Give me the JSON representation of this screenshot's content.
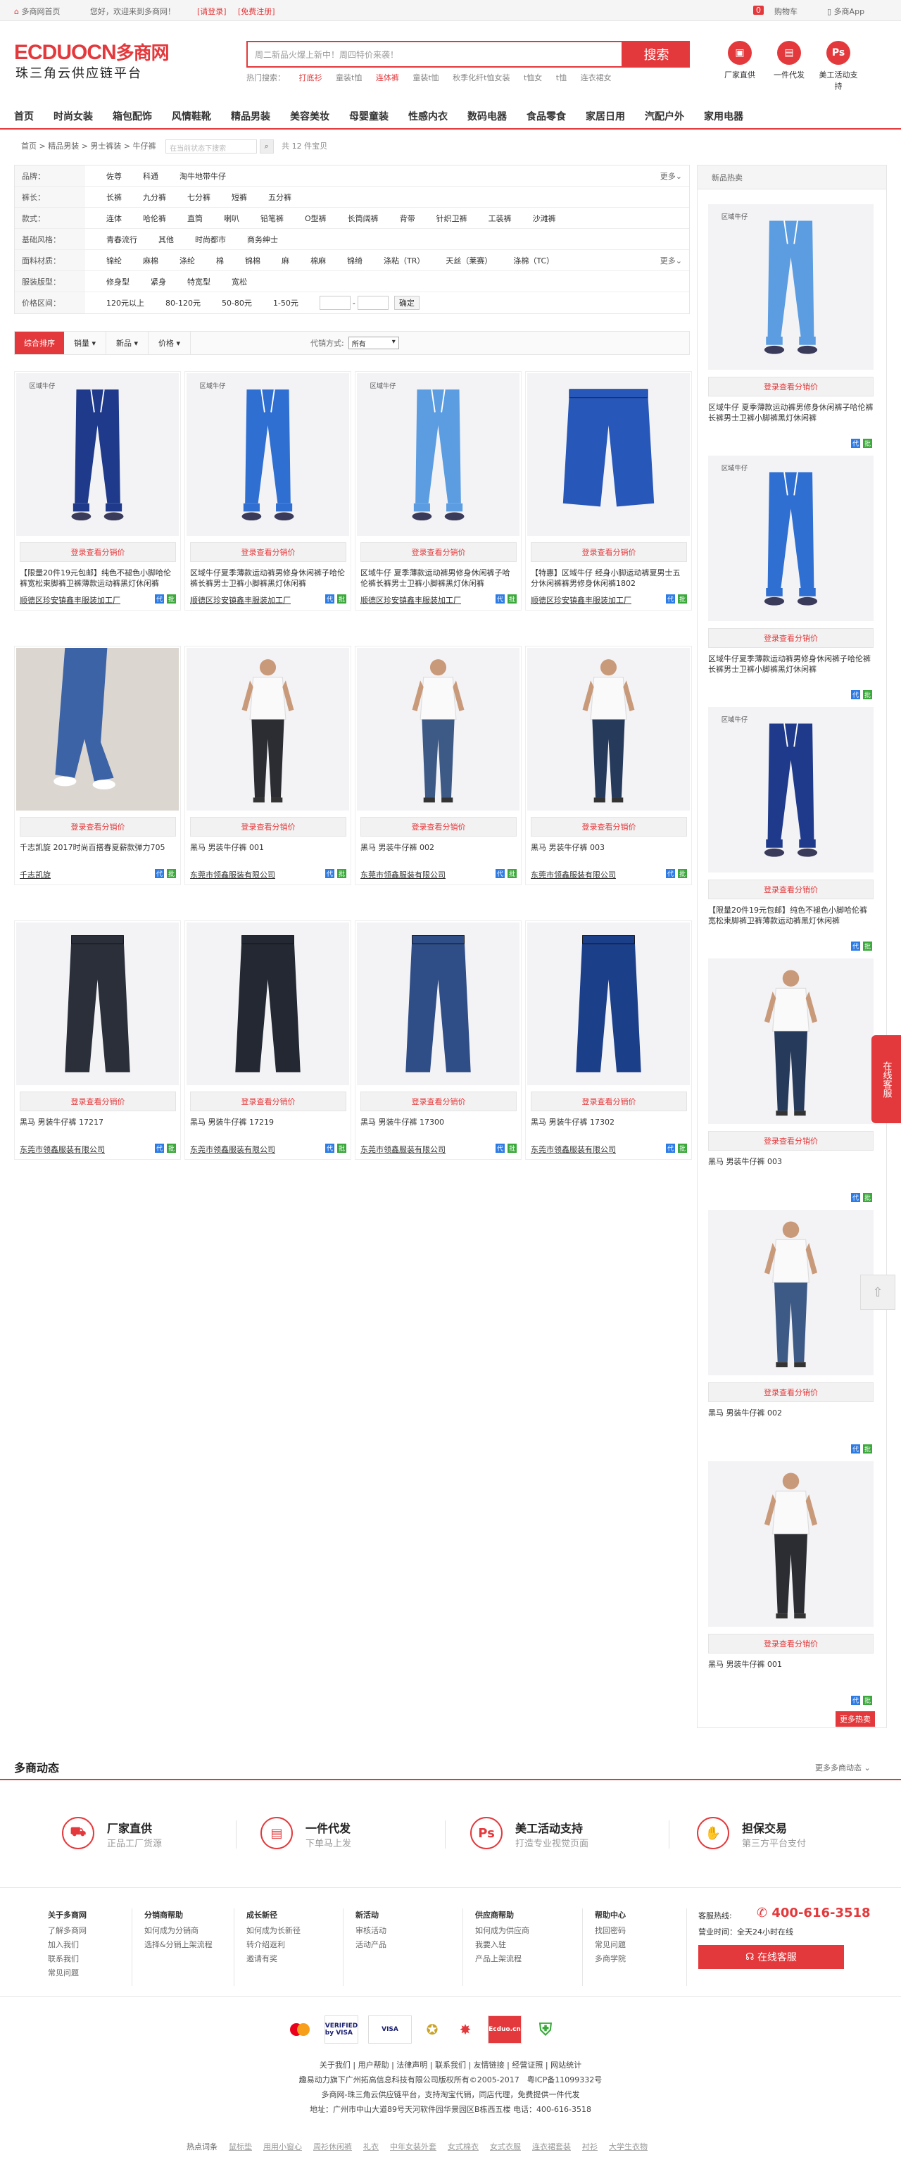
{
  "topbar": {
    "home": "多商网首页",
    "welcome": "您好，欢迎来到多商网！",
    "login": "[请登录]",
    "register": "[免费注册]",
    "cart_count": "0",
    "cart": "购物车",
    "app": "多商App"
  },
  "logo": {
    "brand": "ECDUOCN",
    "cn": "多商网",
    "subtitle": "珠三角云供应链平台"
  },
  "search": {
    "placeholder": "周二新品火爆上新中！周四特价来袭！",
    "button": "搜索",
    "hot_label": "热门搜索：",
    "hot_words": [
      "打底衫",
      "童装t恤",
      "连体裤",
      "童装t恤",
      "秋季化纤t恤女装",
      "t恤女",
      "t恤",
      "连衣裙女"
    ]
  },
  "features": [
    {
      "icon": "factory-icon",
      "label": "厂家直供"
    },
    {
      "icon": "dropship-icon",
      "label": "一件代发"
    },
    {
      "icon": "ps-icon",
      "label": "美工活动支持"
    }
  ],
  "nav": [
    "首页",
    "时尚女装",
    "箱包配饰",
    "风情鞋靴",
    "精品男装",
    "美容美妆",
    "母婴童装",
    "性感内衣",
    "数码电器",
    "食品零食",
    "家居日用",
    "汽配户外",
    "家用电器"
  ],
  "breadcrumb": {
    "items": [
      "首页",
      "精品男装",
      "男士裤装",
      "牛仔裤"
    ],
    "search_placeholder": "在当前状态下搜索",
    "count": "共 12 件宝贝"
  },
  "filters": [
    {
      "label": "品牌：",
      "options": [
        "佐尊",
        "科通",
        "淘牛地带牛仔"
      ],
      "more": "更多"
    },
    {
      "label": "裤长：",
      "options": [
        "长裤",
        "九分裤",
        "七分裤",
        "短裤",
        "五分裤"
      ]
    },
    {
      "label": "款式：",
      "options": [
        "连体",
        "哈伦裤",
        "直筒",
        "喇叭",
        "铅笔裤",
        "O型裤",
        "长筒阔裤",
        "背带",
        "针织卫裤",
        "工装裤",
        "沙滩裤"
      ]
    },
    {
      "label": "基础风格：",
      "options": [
        "青春流行",
        "其他",
        "时尚都市",
        "商务绅士"
      ]
    },
    {
      "label": "面料材质：",
      "options": [
        "锦纶",
        "麻棉",
        "涤纶",
        "棉",
        "锦棉",
        "麻",
        "棉麻",
        "锦绮",
        "涤粘（TR）",
        "天丝（莱赛）",
        "涤棉（TC）"
      ],
      "more": "更多"
    },
    {
      "label": "服装版型：",
      "options": [
        "修身型",
        "紧身",
        "特宽型",
        "宽松"
      ]
    }
  ],
  "price_filter": {
    "label": "价格区间：",
    "options": [
      "120元以上",
      "80-120元",
      "50-80元",
      "1-50元"
    ],
    "dash": "-",
    "confirm": "确定"
  },
  "sortbar": {
    "default": "综合排序",
    "options": [
      "销量 ▾",
      "新品 ▾",
      "价格 ▾"
    ],
    "agent_label": "代销方式:",
    "agent_value": "所有"
  },
  "cta_label": "登录查看分销价",
  "products": [
    {
      "title": "【限量20件19元包邮】纯色不褪色小脚哈伦裤宽松束脚裤卫裤薄款运动裤黑灯休闲裤",
      "seller": "顺德区珍安镇鑫丰服装加工厂",
      "style": "jogger-dark"
    },
    {
      "title": "区域牛仔夏季薄款运动裤男修身休闲裤子哈伦裤长裤男士卫裤小脚裤黑灯休闲裤",
      "seller": "顺德区珍安镇鑫丰服装加工厂",
      "style": "jogger-mid"
    },
    {
      "title": "区域牛仔 夏季薄款运动裤男修身休闲裤子哈伦裤长裤男士卫裤小脚裤黑灯休闲裤",
      "seller": "顺德区珍安镇鑫丰服装加工厂",
      "style": "jogger-light"
    },
    {
      "title": "【特惠】区域牛仔 经身小脚运动裤夏男士五分休闲裤裤男修身休闲裤1802",
      "seller": "顺德区珍安镇鑫丰服装加工厂",
      "style": "shorts"
    },
    {
      "title": "千志凯旋 2017时尚百搭春夏薪款弹力705",
      "seller": "千志凯旋",
      "style": "street"
    },
    {
      "title": "黑马 男装牛仔裤 001",
      "seller": "东莞市领鑫服装有限公司",
      "style": "model-black"
    },
    {
      "title": "黑马 男装牛仔裤 002",
      "seller": "东莞市领鑫服装有限公司",
      "style": "model-ripped"
    },
    {
      "title": "黑马 男装牛仔裤 003",
      "seller": "东莞市领鑫服装有限公司",
      "style": "model-navy"
    },
    {
      "title": "黑马 男装牛仔裤 17217",
      "seller": "东莞市领鑫服装有限公司",
      "style": "flat-black"
    },
    {
      "title": "黑马 男装牛仔裤 17219",
      "seller": "东莞市领鑫服装有限公司",
      "style": "flat-black2"
    },
    {
      "title": "黑马 男装牛仔裤 17300",
      "seller": "东莞市领鑫服装有限公司",
      "style": "flat-blue"
    },
    {
      "title": "黑马 男装牛仔裤 17302",
      "seller": "东莞市领鑫服装有限公司",
      "style": "flat-deep"
    }
  ],
  "sidebar": {
    "heading": "新品热卖",
    "items": [
      {
        "title": "区域牛仔 夏季薄款运动裤男修身休闲裤子哈伦裤长裤男士卫裤小脚裤黑灯休闲裤",
        "style": "jogger-light"
      },
      {
        "title": "区域牛仔夏季薄款运动裤男修身休闲裤子哈伦裤长裤男士卫裤小脚裤黑灯休闲裤",
        "style": "jogger-mid"
      },
      {
        "title": "【限量20件19元包邮】纯色不褪色小脚哈伦裤宽松束脚裤卫裤薄款运动裤黑灯休闲裤",
        "style": "jogger-dark"
      },
      {
        "title": "黑马 男装牛仔裤 003",
        "style": "model-navy"
      },
      {
        "title": "黑马 男装牛仔裤 002",
        "style": "model-ripped"
      },
      {
        "title": "黑马 男装牛仔裤 001",
        "style": "model-black"
      }
    ],
    "more": "更多热卖"
  },
  "float": {
    "customer_service": "在线客服",
    "to_top": "⇧"
  },
  "news": {
    "title": "多商动态",
    "more": "更多多商动态"
  },
  "promises": [
    {
      "icon": "truck-icon",
      "title": "厂家直供",
      "desc": "正品工厂货源"
    },
    {
      "icon": "dropship-icon",
      "title": "一件代发",
      "desc": "下单马上发"
    },
    {
      "icon": "ps-icon",
      "title": "美工活动支持",
      "desc": "打造专业视觉页面"
    },
    {
      "icon": "handshake-icon",
      "title": "担保交易",
      "desc": "第三方平台支付"
    }
  ],
  "footer_cols": [
    {
      "head": "关于多商网",
      "links": [
        "了解多商网",
        "加入我们",
        "联系我们",
        "常见问题"
      ]
    },
    {
      "head": "分销商帮助",
      "links": [
        "如何成为分销商",
        "选择&分销上架流程"
      ]
    },
    {
      "head": "成长新径",
      "links": [
        "如何成为长新径",
        "转介绍返利",
        "邀请有奖"
      ]
    },
    {
      "head": "新活动",
      "links": [
        "审核活动",
        "活动产品"
      ]
    },
    {
      "head": "供应商帮助",
      "links": [
        "如何成为供应商",
        "我要入驻",
        "产品上架流程"
      ]
    },
    {
      "head": "帮助中心",
      "links": [
        "找回密码",
        "常见问题",
        "多商学院"
      ]
    }
  ],
  "contact": {
    "hotline_label": "客服热线:",
    "hotline": "400-616-3518",
    "service_time": "营业时间：全天24小时在线",
    "online_button": "在线客服"
  },
  "certs": [
    "MasterCard",
    "VERIFIED by VISA",
    "VISA",
    "诚信网站",
    "可信网站",
    "Ecduo.cn",
    "安全认证"
  ],
  "footer_links": "关于我们 | 用户帮助 | 法律声明 | 联系我们 | 友情链接 | 经营证照 | 网站统计",
  "copyright": [
    "趣易动力旗下广州拓高信息科技有限公司版权所有©2005-2017　粤ICP备11099332号",
    "多商网-珠三角云供应链平台，支持淘宝代销，同店代理，免费提供一件代发",
    "地址：广州市中山大道89号天河软件园华景园区B栋西五楼 电话：400-616-3518"
  ],
  "hot_search": {
    "label": "热点词条",
    "words": [
      "鼠标垫",
      "用用小窗心",
      "周衫休闲裤",
      "礼衣",
      "中年女装外套",
      "女式棉衣",
      "女式衣服",
      "连衣裙套装",
      "衬衫",
      "大学生衣物"
    ]
  }
}
